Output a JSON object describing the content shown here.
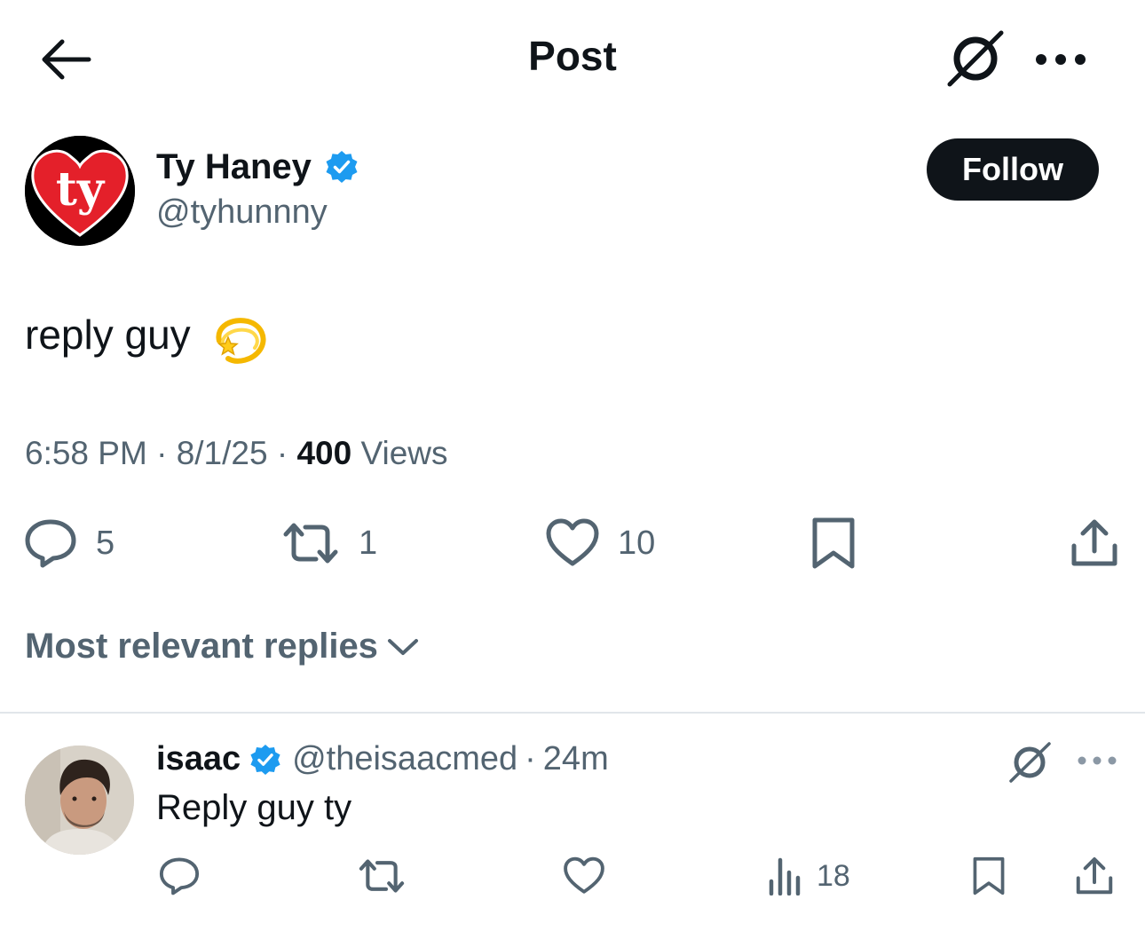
{
  "header": {
    "title": "Post",
    "back_icon": "arrow-left-icon",
    "grok_icon": "grok-icon",
    "more_icon": "more-horizontal-icon"
  },
  "post": {
    "author": {
      "name": "Ty Haney",
      "handle": "@tyhunnny",
      "verified": true,
      "avatar_text": "ty"
    },
    "follow_label": "Follow",
    "text": "reply guy",
    "emoji": "dizzy-star-emoji",
    "time": "6:58 PM",
    "date": "8/1/25",
    "views_count": "400",
    "views_label": "Views",
    "separator": "·",
    "stats": {
      "replies": "5",
      "reposts": "1",
      "likes": "10"
    }
  },
  "replies_section": {
    "sort_label": "Most relevant replies"
  },
  "reply": {
    "name": "isaac",
    "verified": true,
    "handle": "@theisaacmed",
    "age": "24m",
    "text": "Reply guy ty",
    "views": "18"
  },
  "colors": {
    "text_primary": "#0f1419",
    "text_secondary": "#536471",
    "verified_blue": "#1d9bf0",
    "follow_bg": "#0f1419",
    "ty_red": "#e4202a"
  }
}
